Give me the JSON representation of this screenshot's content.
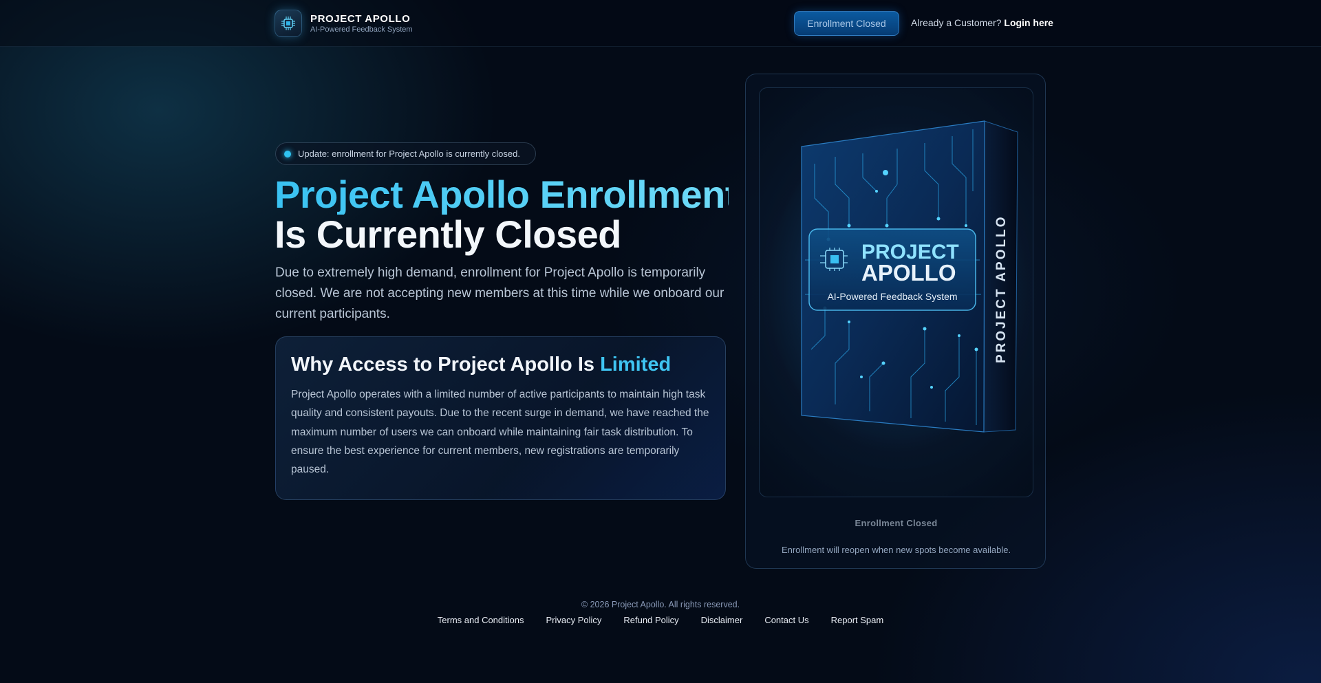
{
  "header": {
    "brand_name": "PROJECT APOLLO",
    "brand_tagline": "AI-Powered Feedback System",
    "enroll_button": "Enrollment Closed",
    "login_prompt": "Already a Customer?",
    "login_link": "Login here"
  },
  "hero": {
    "update_badge": "Update: enrollment for Project Apollo is currently closed.",
    "title_line1": "Project Apollo Enrollment",
    "title_line2": "Is Currently Closed",
    "description": "Due to extremely high demand, enrollment for Project Apollo is temporarily closed. We are not accepting new members at this time while we onboard our current participants."
  },
  "why_card": {
    "title_prefix": "Why Access to Project Apollo Is",
    "title_accent": "Limited",
    "body": "Project Apollo operates with a limited number of active participants to maintain high task quality and consistent payouts. Due to the recent surge in demand, we have reached the maximum number of users we can onboard while maintaining fair task distribution. To ensure the best experience for current members, new registrations are temporarily paused."
  },
  "product": {
    "box_title_line1": "PROJECT",
    "box_title_line2": "APOLLO",
    "box_subtitle": "AI-Powered Feedback System",
    "box_side_text": "PROJECT APOLLO",
    "status": "Enrollment Closed",
    "note": "Enrollment will reopen when new spots become available."
  },
  "footer": {
    "copyright": "© 2026 Project Apollo. All rights reserved.",
    "links": [
      "Terms and Conditions",
      "Privacy Policy",
      "Refund Policy",
      "Disclaimer",
      "Contact Us",
      "Report Spam"
    ]
  },
  "colors": {
    "accent": "#3fc5f2",
    "background": "#040b17",
    "button": "#0b5aa0"
  },
  "icons": {
    "brand_logo": "chip-icon",
    "update_indicator": "status-dot-icon"
  }
}
